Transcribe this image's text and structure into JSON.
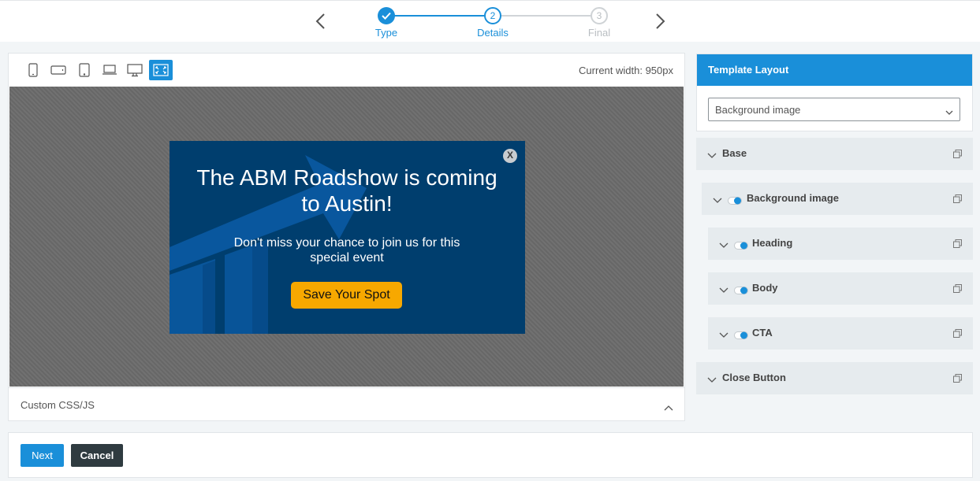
{
  "stepper": {
    "steps": [
      {
        "number": "",
        "label": "Type",
        "state": "complete"
      },
      {
        "number": "2",
        "label": "Details",
        "state": "current"
      },
      {
        "number": "3",
        "label": "Final",
        "state": "upcoming"
      }
    ]
  },
  "preview": {
    "devices": [
      "mobile-portrait-icon",
      "mobile-landscape-icon",
      "tablet-icon",
      "laptop-icon",
      "desktop-icon",
      "fullscreen-icon"
    ],
    "current_width": "Current width: 950px",
    "popup": {
      "close_label": "X",
      "heading": "The ABM Roadshow is coming to Austin!",
      "body": "Don't miss your chance to join us for this special event",
      "cta": "Save Your Spot"
    },
    "custom_css_label": "Custom CSS/JS"
  },
  "template_layout": {
    "title": "Template Layout",
    "selected": "Background image"
  },
  "layers": [
    {
      "name": "Base"
    },
    {
      "name": "Background image"
    },
    {
      "name": "Heading"
    },
    {
      "name": "Body"
    },
    {
      "name": "CTA"
    },
    {
      "name": "Close Button"
    }
  ],
  "footer": {
    "next": "Next",
    "cancel": "Cancel"
  },
  "colors": {
    "accent": "#1a8fd9",
    "popup_bg": "#003e6e",
    "cta": "#f7a800",
    "cancel_bg": "#2f3b40"
  }
}
